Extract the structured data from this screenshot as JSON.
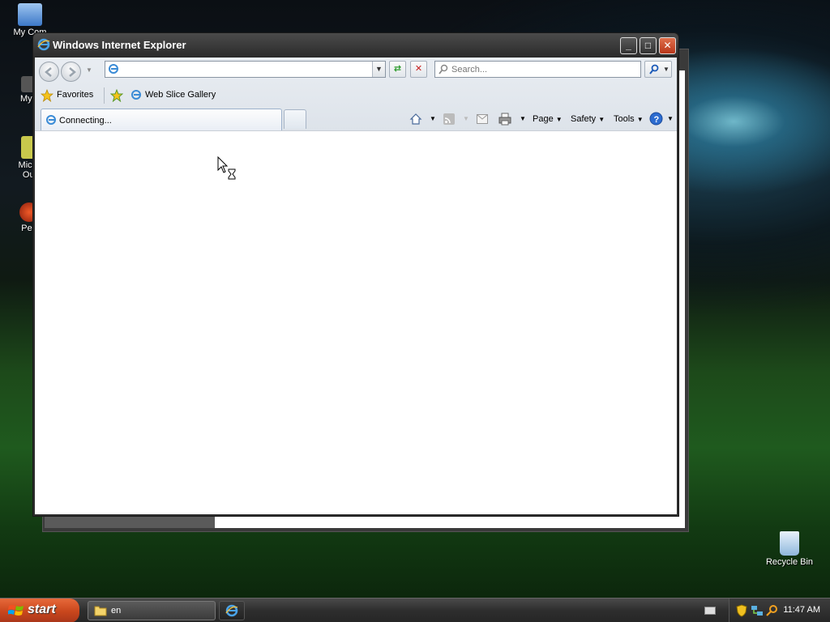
{
  "desktop": {
    "icons": [
      {
        "label": "My Com"
      },
      {
        "label": "MyP"
      },
      {
        "label": "Micro"
      },
      {
        "label": "Outl"
      },
      {
        "label": "Pe"
      },
      {
        "label": "Recycle Bin"
      }
    ]
  },
  "window": {
    "title": "Windows Internet Explorer",
    "address": {
      "value": "",
      "placeholder": ""
    },
    "search": {
      "placeholder": "Search..."
    },
    "favorites_label": "Favorites",
    "web_slice_label": "Web Slice Gallery",
    "tab": {
      "label": "Connecting..."
    },
    "command_bar": {
      "page_label": "Page",
      "safety_label": "Safety",
      "tools_label": "Tools"
    }
  },
  "taskbar": {
    "start_label": "start",
    "tasks": [
      {
        "label": "en"
      }
    ],
    "clock": "11:47 AM"
  },
  "colors": {
    "start_orange": "#c8461c",
    "taskbar": "#2e2e2e",
    "titlebar": "#2a2a2a"
  }
}
